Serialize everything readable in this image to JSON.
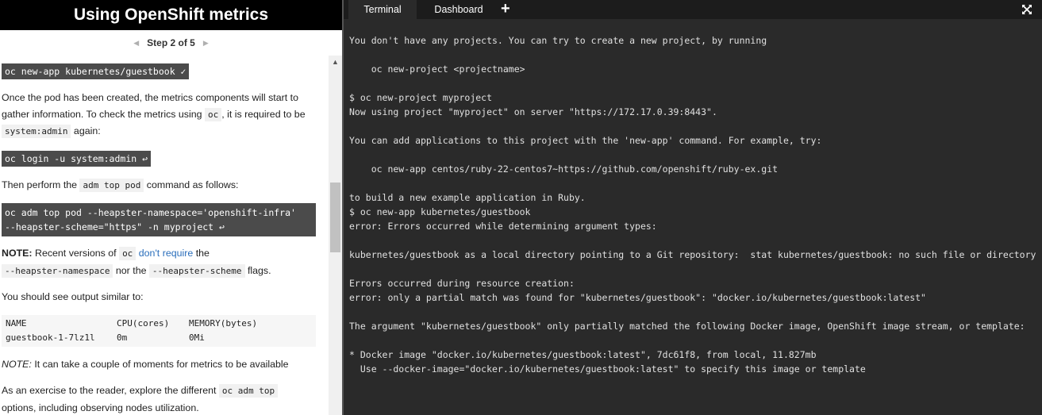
{
  "left": {
    "title": "Using OpenShift metrics",
    "step": "Step 2 of 5",
    "code1": "oc new-app kubernetes/guestbook ✓",
    "p1_a": "Once the pod has been created, the metrics components will start to gather information. To check the metrics using ",
    "p1_code1": "oc",
    "p1_b": ", it is required to be ",
    "p1_code2": "system:admin",
    "p1_c": " again:",
    "code2": "oc login -u system:admin ↩",
    "p2_a": "Then perform the ",
    "p2_code": "adm top pod",
    "p2_b": " command as follows:",
    "code3_l1": "oc adm top pod --heapster-namespace='openshift-infra'",
    "code3_l2": "--heapster-scheme=\"https\" -n myproject ↩",
    "note_label": "NOTE:",
    "note_a": " Recent versions of ",
    "note_code1": "oc",
    "note_link": "don't require",
    "note_b": " the ",
    "note_code2": "--heapster-namespace",
    "note_c": " nor the ",
    "note_code3": "--heapster-scheme",
    "note_d": " flags.",
    "p3": "You should see output similar to:",
    "table": {
      "headers": [
        "NAME",
        "CPU(cores)",
        "MEMORY(bytes)"
      ],
      "row": [
        "guestbook-1-7lz1l",
        "0m",
        "0Mi"
      ]
    },
    "note2_label": "NOTE:",
    "note2_text": " It can take a couple of moments for metrics to be available",
    "p4_a": "As an exercise to the reader, explore the different ",
    "p4_code": "oc adm top",
    "p4_b": " options, including observing nodes utilization."
  },
  "right": {
    "tabs": [
      "Terminal",
      "Dashboard"
    ],
    "lines": [
      "You don't have any projects. You can try to create a new project, by running",
      "",
      "    oc new-project <projectname>",
      "",
      "$ oc new-project myproject",
      "Now using project \"myproject\" on server \"https://172.17.0.39:8443\".",
      "",
      "You can add applications to this project with the 'new-app' command. For example, try:",
      "",
      "    oc new-app centos/ruby-22-centos7~https://github.com/openshift/ruby-ex.git",
      "",
      "to build a new example application in Ruby.",
      "$ oc new-app kubernetes/guestbook",
      "error: Errors occurred while determining argument types:",
      "",
      "kubernetes/guestbook as a local directory pointing to a Git repository:  stat kubernetes/guestbook: no such file or directory",
      "",
      "Errors occurred during resource creation:",
      "error: only a partial match was found for \"kubernetes/guestbook\": \"docker.io/kubernetes/guestbook:latest\"",
      "",
      "The argument \"kubernetes/guestbook\" only partially matched the following Docker image, OpenShift image stream, or template:",
      "",
      "* Docker image \"docker.io/kubernetes/guestbook:latest\", 7dc61f8, from local, 11.827mb",
      "  Use --docker-image=\"docker.io/kubernetes/guestbook:latest\" to specify this image or template",
      "",
      "",
      "$"
    ]
  },
  "colors": {
    "header_bg": "#000000",
    "code_bg": "#4b4b4b",
    "terminal_bg": "#2a2a2a",
    "tabbar_bg": "#1c1c1c",
    "link": "#2a6ebb"
  }
}
